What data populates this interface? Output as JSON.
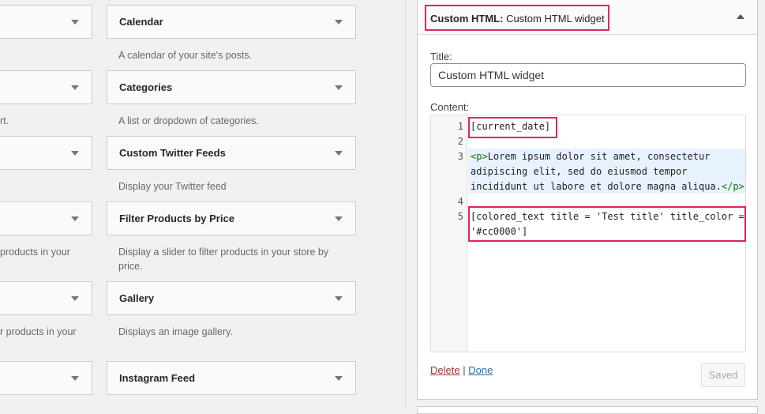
{
  "left_column": [
    {
      "desc": ""
    },
    {
      "desc": "rt."
    },
    {
      "desc": ""
    },
    {
      "desc": "products in your"
    },
    {
      "desc": "r products in your"
    },
    {
      "desc": ""
    }
  ],
  "widgets": [
    {
      "title": "Calendar",
      "desc": "A calendar of your site's posts."
    },
    {
      "title": "Categories",
      "desc": "A list or dropdown of categories."
    },
    {
      "title": "Custom Twitter Feeds",
      "desc": "Display your Twitter feed"
    },
    {
      "title": "Filter Products by Price",
      "desc": "Display a slider to filter products in your store by price."
    },
    {
      "title": "Gallery",
      "desc": "Displays an image gallery."
    },
    {
      "title": "Instagram Feed",
      "desc": ""
    }
  ],
  "panel": {
    "header_type": "Custom HTML:",
    "header_name": "Custom HTML widget",
    "title_label": "Title:",
    "title_value": "Custom HTML widget",
    "content_label": "Content:",
    "lines": {
      "n1": "1",
      "n2": "2",
      "n3": "3",
      "n4": "4",
      "n5": "5",
      "l1": "[current_date]",
      "l3_open": "<p>",
      "l3a": "Lorem ipsum dolor sit amet, consectetur",
      "l3b": "adipiscing elit, sed do eiusmod tempor",
      "l3c": "incididunt ut labore et dolore magna aliqua.",
      "l3_close": "</p>",
      "l5a": "[colored_text title = 'Test title' title_color =",
      "l5b": "'#cc0000']"
    },
    "delete": "Delete",
    "sep": "|",
    "done": "Done",
    "saved": "Saved"
  },
  "colors": {
    "highlight": "#e0245e",
    "tag": "#117700",
    "delete": "#b32d2e",
    "link": "#2271b1"
  }
}
